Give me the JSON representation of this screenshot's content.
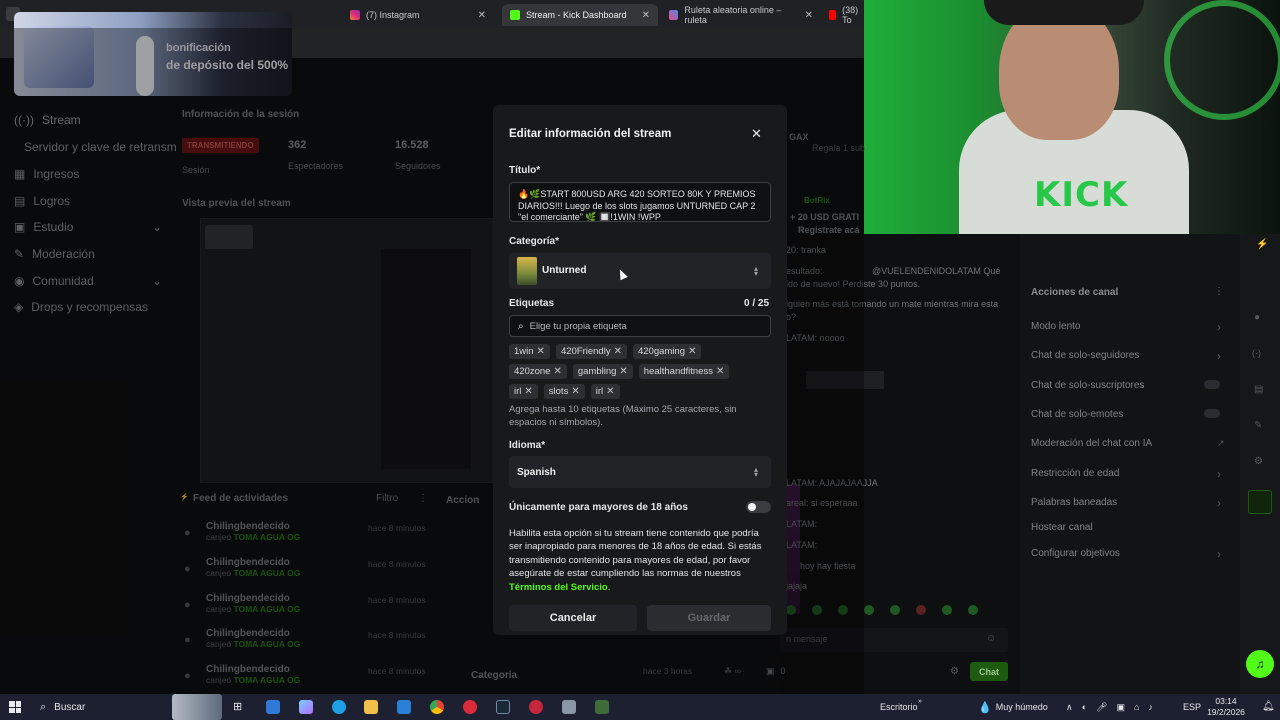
{
  "browser": {
    "tabs": [
      {
        "label": "(7) Instagram",
        "active": false
      },
      {
        "label": "Stream - Kick Dashboard",
        "active": true
      },
      {
        "label": "Ruleta aleatoria online – ruleta",
        "active": false
      },
      {
        "label": "(38) To",
        "active": false
      }
    ]
  },
  "promo": {
    "line1": "bonificación",
    "line2": "de depósito del 500%"
  },
  "sidebar": {
    "items": [
      {
        "label": "Stream",
        "icon": "broadcast-icon"
      },
      {
        "label": "Servidor y clave de retransm",
        "icon": ""
      },
      {
        "label": "Ingresos",
        "icon": "revenue-icon"
      },
      {
        "label": "Logros",
        "icon": "trophy-icon"
      },
      {
        "label": "Estudio",
        "icon": "studio-icon"
      },
      {
        "label": "Moderación",
        "icon": "wrench-icon"
      },
      {
        "label": "Comunidad",
        "icon": "community-icon"
      },
      {
        "label": "Drops y recompensas",
        "icon": "drops-icon"
      }
    ]
  },
  "session": {
    "heading": "Información de la sesión",
    "status": "TRANSMITIENDO",
    "status_label": "Sesión",
    "viewers": "362",
    "viewers_label": "Espectadores",
    "followers": "16.528",
    "followers_label": "Seguidores",
    "preview_heading": "Vista previa del stream"
  },
  "activity": {
    "heading": "Feed de actividades",
    "filter": "Filtro",
    "actions_heading": "Accion",
    "items": [
      {
        "user": "Chilingbendecido",
        "action": "canjeó",
        "reward": "TOMA AGUA OG",
        "time": "hace 8 minutos"
      },
      {
        "user": "Chilingbendecido",
        "action": "canjeó",
        "reward": "TOMA AGUA OG",
        "time": "hace 8 minutos"
      },
      {
        "user": "Chilingbendecido",
        "action": "canjeó",
        "reward": "TOMA AGUA OG",
        "time": "hace 8 minutos"
      },
      {
        "user": "Chilingbendecido",
        "action": "canjeó",
        "reward": "TOMA AGUA OG",
        "time": "hace 8 minutos"
      },
      {
        "user": "Chilingbendecido",
        "action": "canjeó",
        "reward": "TOMA AGUA OG",
        "time": "hace 8 minutos"
      }
    ],
    "category_row": {
      "label": "Categoría",
      "time": "hace 3 horas",
      "note": "cambiado a Just Chatting por chiling_og"
    }
  },
  "chat": {
    "lines": [
      "GAX",
      "BotRix",
      "+ 20 USD GRATI",
      "Registrate acá",
      "20: tranka",
      "esultado:",
      "@VUELENDENIDOLATAM Qué",
      "ido de nuevo! Perdiste 30 puntos.",
      "lguien más está tomando un mate mientras mira esta",
      "o?",
      "LATAM: noooo",
      "LATAM: AJAJAJAAJJA",
      "areal: si esperaaa",
      "LATAM:",
      "LATAM:",
      "hoy hay fiesta",
      "jajaja",
      "n mensaje"
    ],
    "send_label": "Chat",
    "count": "0",
    "slow_label": "Regala 1 sub"
  },
  "channel_actions": {
    "heading": "Acciones de canal",
    "items": [
      {
        "label": "Modo lento",
        "control": "chevron"
      },
      {
        "label": "Chat de solo-seguidores",
        "control": "chevron"
      },
      {
        "label": "Chat de solo-suscriptores",
        "control": "toggle"
      },
      {
        "label": "Chat de solo-emotes",
        "control": "toggle"
      },
      {
        "label": "Moderación del chat con IA",
        "control": "link"
      },
      {
        "label": "Restricción de edad",
        "control": "chevron"
      },
      {
        "label": "Palabras baneadas",
        "control": "chevron"
      },
      {
        "label": "Hostear canal",
        "control": "none"
      },
      {
        "label": "Configurar objetivos",
        "control": "chevron"
      }
    ]
  },
  "modal": {
    "heading": "Editar información del stream",
    "title_label": "Título*",
    "title_value": "🔥🌿START 800USD ARG 420 SORTEO 80K Y PREMIOS DIARIOS!!! Luego de los slots jugamos UNTURNED CAP 2 \"el comerciante\" 🌿 🔲!1WIN !WPP",
    "category_label": "Categoría*",
    "category_value": "Unturned",
    "tags_label": "Etiquetas",
    "tags_count": "0 / 25",
    "tags_placeholder": "Elige tu propia etiqueta",
    "tags": [
      "1win",
      "420Friendly",
      "420gaming",
      "420zone",
      "gambling",
      "healthandfitness",
      "irl",
      "slots",
      "irl"
    ],
    "tags_help": "Agrega hasta 10 etiquetas (Máximo 25 caracteres, sin espacios ni símbolos).",
    "language_label": "Idioma*",
    "language_value": "Spanish",
    "adult_label": "Únicamente para mayores de 18 años",
    "adult_enabled": false,
    "adult_desc": "Habilita esta opción si tu stream tiene contenido que podría ser inapropiado para menores de 18 años de edad. Si estás transmitiendo contenido para mayores de edad, por favor asegúrate de estar cumpliendo las normas de nuestros ",
    "terms_link": "Términos del Servicio",
    "terms_end": ".",
    "cancel": "Cancelar",
    "save": "Guardar"
  },
  "taskbar": {
    "search": "Buscar",
    "desktop": "Escritorio",
    "weather": "Muy húmedo",
    "lang": "ESP",
    "time": "03:14",
    "date": "19/2/2026"
  },
  "colors": {
    "kick_green": "#53fc18",
    "live_red": "#d0282b",
    "modal_bg": "#18191b"
  }
}
